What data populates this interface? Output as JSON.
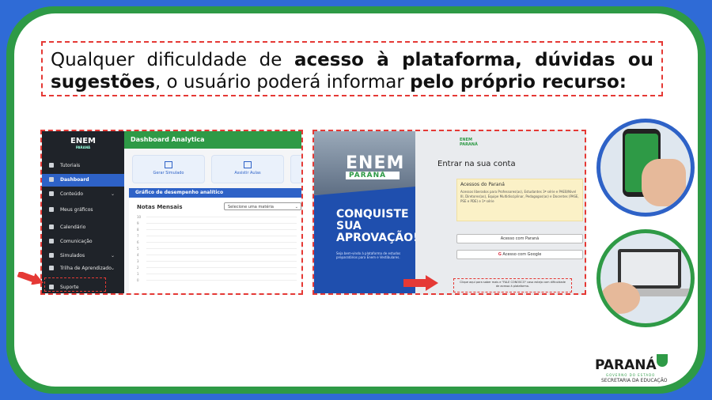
{
  "headline": {
    "p1": "Qualquer dificuldade de ",
    "b1": "acesso à plataforma, dúvidas ou sugestões",
    "p2": ", o usuário poderá informar ",
    "b2": "pelo próprio recurso:"
  },
  "dashboard": {
    "logo": "ENEM",
    "logo_sub": "PARANÁ",
    "header_title": "Dashboard Analytica",
    "sidebar": [
      {
        "label": "Tutoriais",
        "icon": "tutorial-icon"
      },
      {
        "label": "Dashboard",
        "icon": "dashboard-icon",
        "active": true
      },
      {
        "label": "Conteúdo",
        "icon": "content-icon",
        "chevron": true
      },
      {
        "label": "Meus gráficos",
        "icon": "charts-icon"
      },
      {
        "label": "Calendário",
        "icon": "calendar-icon"
      },
      {
        "label": "Comunicação",
        "icon": "chat-icon"
      },
      {
        "label": "Simulados",
        "icon": "exam-icon",
        "chevron": true
      },
      {
        "label": "Trilha de Aprendizado",
        "icon": "path-icon",
        "chevron": true
      },
      {
        "label": "Suporte",
        "icon": "support-icon"
      }
    ],
    "tiles": [
      "Gerar Simulado",
      "Assistir Aulas"
    ],
    "chart_header": "Gráfico de desempenho analítico",
    "chart_title": "Notas Mensais",
    "select_placeholder": "Selecione uma matéria",
    "y_ticks": [
      "10",
      "9",
      "8",
      "7",
      "6",
      "5",
      "4",
      "3",
      "2",
      "1",
      "0"
    ]
  },
  "login": {
    "promo_logo": "ENEM",
    "promo_logo_sub": "PARANÁ",
    "promo_headline": "CONQUISTE SUA APROVAÇÃO!",
    "promo_sub": "Seja bem-vindo à plataforma de estudos preparatórios para Enem e Vestibulares.",
    "logo": "ENEM",
    "logo_sub": "PARANÁ",
    "title": "Entrar na sua conta",
    "notice_title": "Acessos do Paraná",
    "notice_text": "Acessos liberados para Professores(as), Estudantes 3ª série e PAEB/Nível III, Diretores(as), Equipe Multidisciplinar, Pedagogos(as) e Docentes (PASE, PSE e PDE) e 1ª série",
    "btn_parana": "Acesso com Paraná",
    "btn_google": "Acesso com Google",
    "help_text": "Clique aqui para saber mais e \"FALE CONOSCO\" caso esteja com dificuldade de acesso à plataforma."
  },
  "footer_logo": {
    "word": "PARANÁ",
    "sub1": "GOVERNO DO ESTADO",
    "sub2": "SECRETARIA DA EDUCAÇÃO"
  },
  "colors": {
    "green": "#2e9a46",
    "blue": "#2e62c7",
    "red": "#e53935"
  }
}
